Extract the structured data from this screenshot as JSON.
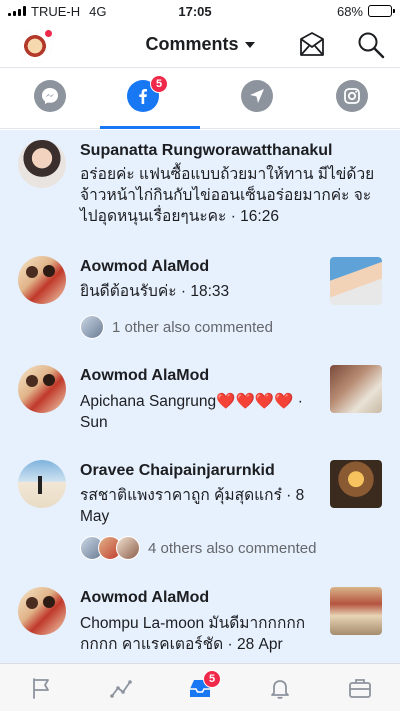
{
  "status_bar": {
    "carrier": "TRUE-H",
    "network": "4G",
    "time": "17:05",
    "battery": "68%",
    "battery_level": 0.68
  },
  "header": {
    "title": "Comments",
    "icons": [
      "page-avatar",
      "mail-icon",
      "search-icon"
    ]
  },
  "tabs": {
    "items": [
      {
        "icon": "messenger-icon",
        "active": false
      },
      {
        "icon": "facebook-icon",
        "active": true,
        "badge": "5"
      },
      {
        "icon": "direct-icon",
        "active": false
      },
      {
        "icon": "instagram-icon",
        "active": false
      }
    ]
  },
  "comments": [
    {
      "name": "Supanatta Rungworawatthanakul",
      "text": "อร่อยค่ะ แฟนซื้อแบบถ้วยมาให้ทาน มีไข่ด้วยจ้าวหน้าไก่กินกับไข่ออนเซ็นอร่อยมากค่ะ จะไปอุดหนุนเรื่อยๆนะคะ",
      "time": "16:26",
      "unread": true
    },
    {
      "name": "Aowmod AlaMod",
      "text": "ยินดีต้อนรับค่ะ",
      "time": "18:33",
      "others": "1 other also commented",
      "unread": true
    },
    {
      "name": "Aowmod AlaMod",
      "text": "Apichana Sangrung❤️❤️❤️❤️",
      "time": "Sun",
      "unread": true
    },
    {
      "name": "Oravee Chaipainjarurnkid",
      "text": "รสชาติแพงราคาถูก คุ้มสุดแกร๋",
      "time": "8 May",
      "others": "4 others also commented",
      "unread": true
    },
    {
      "name": "Aowmod AlaMod",
      "text": "Chompu La-moon มันดีมากกกกกกกกก คาแรคเตอร์ชัด",
      "time": "28 Apr",
      "unread": true
    }
  ],
  "bottom_nav": {
    "items": [
      "flag-icon",
      "insights-icon",
      "inbox-icon",
      "bell-icon",
      "briefcase-icon"
    ],
    "inbox_badge": "5"
  },
  "colors": {
    "accent": "#1877f2",
    "badge": "#f02849",
    "unread_bg": "#e7f0fd",
    "muted": "#65676b"
  }
}
